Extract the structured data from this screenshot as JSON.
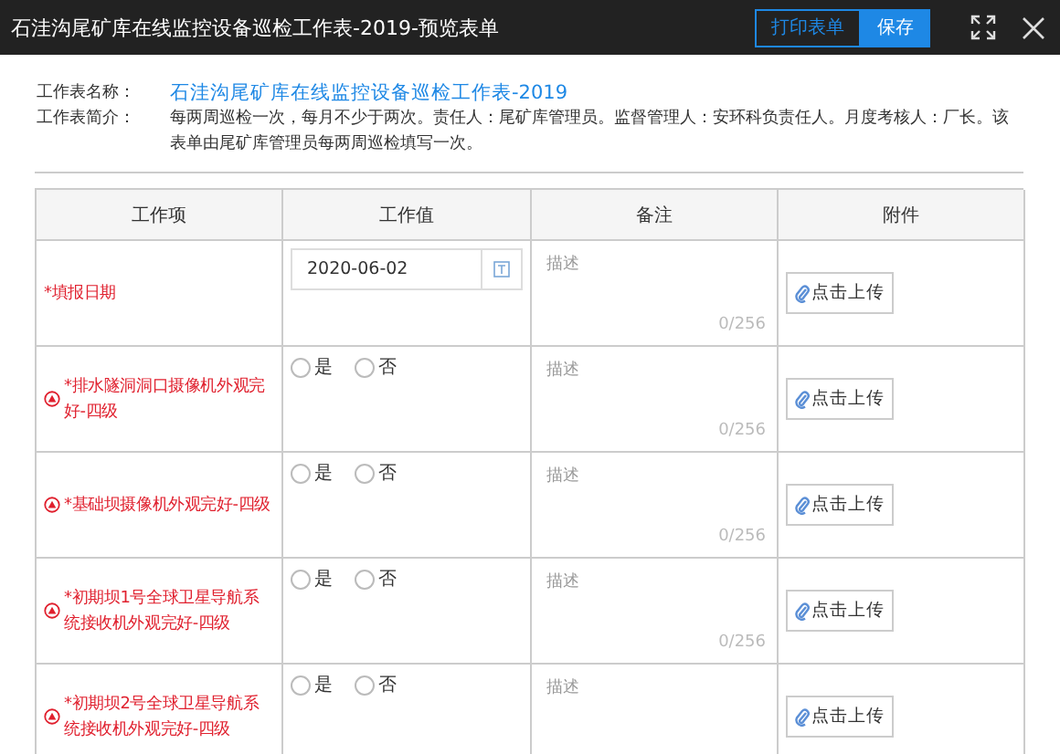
{
  "window": {
    "title": "石洼沟尾矿库在线监控设备巡检工作表-2019-预览表单",
    "buttons": [
      {
        "label": "打印表单",
        "primary": false
      },
      {
        "label": "保存",
        "primary": true
      }
    ]
  },
  "info": [
    {
      "label": "工作表名称：",
      "value": "石洼沟尾矿库在线监控设备巡检工作表-2019",
      "kind": "link"
    },
    {
      "label": "工作表简介：",
      "value": "每两周巡检一次，每月不少于两次。责任人：尾矿库管理员。监督管理人：安环科负责任人。月度考核人：厂长。该表单由尾矿库管理员每两周巡检填写一次。",
      "kind": "text"
    }
  ],
  "table": {
    "columns": [
      "工作项",
      "工作值",
      "备注",
      "附件"
    ],
    "rows": [
      {
        "label": "*填报日期",
        "kind": "date",
        "has_icon": false,
        "value": "2020-06-02",
        "remark_placeholder": "描述",
        "counter": "0/256",
        "upload": "点击上传"
      },
      {
        "label": "*排水隧洞洞口摄像机外观完好-四级",
        "kind": "radio",
        "has_icon": true,
        "options": [
          {
            "label": "是",
            "selected": false
          },
          {
            "label": "否",
            "selected": false
          }
        ],
        "remark_placeholder": "描述",
        "counter": "0/256",
        "upload": "点击上传"
      },
      {
        "label": "*基础坝摄像机外观完好-四级",
        "kind": "radio",
        "has_icon": true,
        "options": [
          {
            "label": "是",
            "selected": false
          },
          {
            "label": "否",
            "selected": false
          }
        ],
        "remark_placeholder": "描述",
        "counter": "0/256",
        "upload": "点击上传"
      },
      {
        "label": "*初期坝1号全球卫星导航系统接收机外观完好-四级",
        "kind": "radio",
        "has_icon": true,
        "options": [
          {
            "label": "是",
            "selected": false
          },
          {
            "label": "否",
            "selected": false
          }
        ],
        "remark_placeholder": "描述",
        "counter": "0/256",
        "upload": "点击上传"
      },
      {
        "label": "*初期坝2号全球卫星导航系统接收机外观完好-四级",
        "kind": "radio",
        "has_icon": true,
        "options": [
          {
            "label": "是",
            "selected": false
          },
          {
            "label": "否",
            "selected": false
          }
        ],
        "remark_placeholder": "描述",
        "upload": "点击上传"
      }
    ]
  }
}
